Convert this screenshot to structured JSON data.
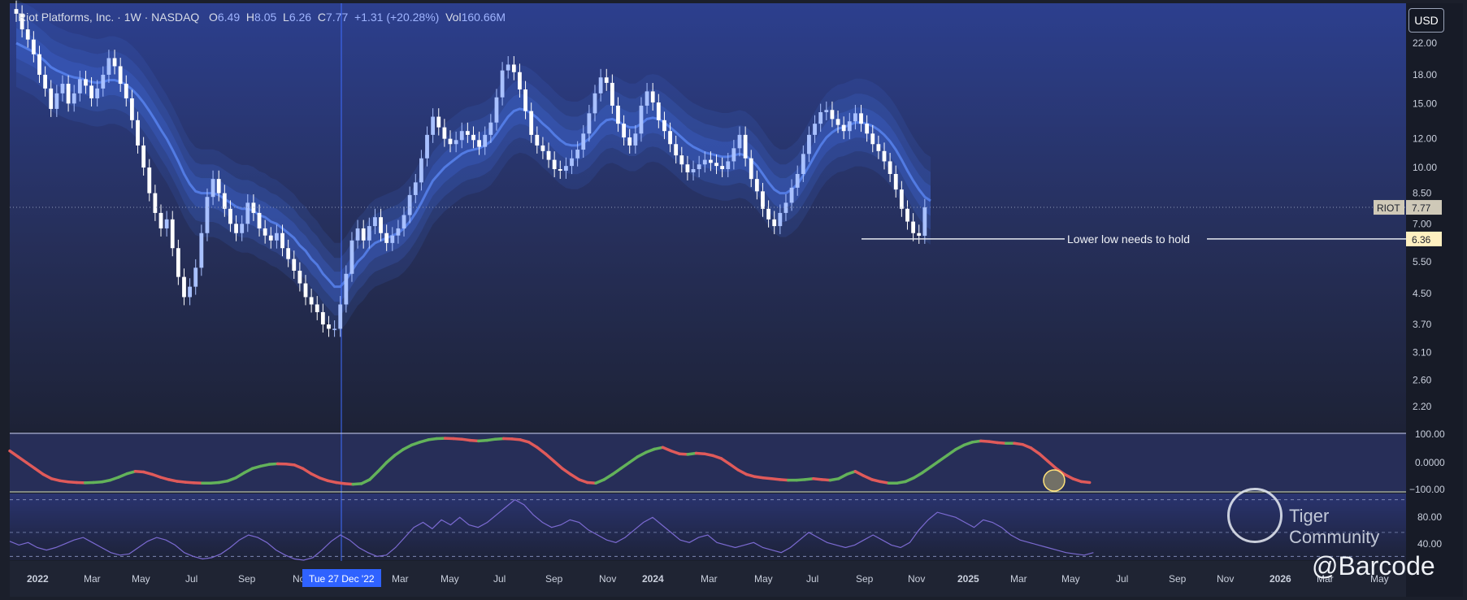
{
  "header": {
    "symbol_name": "Riot Platforms, Inc.",
    "interval": "1W",
    "exchange": "NASDAQ",
    "open_label": "O",
    "open": "6.49",
    "high_label": "H",
    "high": "8.05",
    "low_label": "L",
    "low": "6.26",
    "close_label": "C",
    "close": "7.77",
    "change": "+1.31 (+20.28%)",
    "vol_label": "Vol",
    "volume": "160.66M"
  },
  "currency_button": "USD",
  "watermark": {
    "brand": "Tiger Community",
    "handle": "@Barcode"
  },
  "colors": {
    "up": "#a9c1ff",
    "down": "#ffffff",
    "ribbon": "#3f68d6",
    "ribbon_teal": "#3fb8a8",
    "osc_up": "#63b25a",
    "osc_down": "#e05a5a",
    "rsi": "#7b6ad1",
    "accent": "#2f62ff"
  },
  "chart_data": {
    "type": "candlestick",
    "scale": "log",
    "price_axis_ticks": [
      "22.00",
      "18.00",
      "15.00",
      "12.00",
      "10.00",
      "8.50",
      "7.00",
      "5.50",
      "4.50",
      "3.70",
      "3.10",
      "2.60",
      "2.20"
    ],
    "price_axis_values": [
      22,
      18,
      15,
      12,
      10,
      8.5,
      7,
      5.5,
      4.5,
      3.7,
      3.1,
      2.6,
      2.2
    ],
    "time_axis_ticks": [
      "2022",
      "Mar",
      "May",
      "Jul",
      "Sep",
      "No",
      "Mar",
      "May",
      "Jul",
      "Sep",
      "Nov",
      "2024",
      "Mar",
      "May",
      "Jul",
      "Sep",
      "Nov",
      "2025",
      "Mar",
      "May",
      "Jul",
      "Sep",
      "Nov",
      "2026",
      "Mar",
      "May"
    ],
    "crosshair_date": "Tue 27 Dec '22",
    "price_labels": [
      {
        "name": "RIOT",
        "value": "7.77"
      },
      {
        "name": "",
        "value": "6.36"
      }
    ],
    "support_line": {
      "value": 6.36,
      "label": "Lower low needs to hold"
    },
    "oscillator_ticks": [
      "100.00",
      "0.0000",
      "−100.00"
    ],
    "rsi_ticks": [
      "80.00",
      "40.00"
    ],
    "closes": [
      26.5,
      24,
      22.5,
      20.5,
      18,
      16.5,
      14.5,
      16,
      17,
      15,
      16,
      17.5,
      16.8,
      15.5,
      16.5,
      18,
      20,
      19,
      17,
      15.5,
      13.5,
      11.5,
      10,
      8.5,
      7.5,
      6.8,
      7.2,
      6,
      5,
      4.4,
      4.7,
      5.3,
      6.6,
      8.3,
      9.3,
      8.5,
      7.7,
      7,
      6.6,
      7,
      8,
      7.5,
      6.8,
      6.5,
      6.3,
      6.6,
      6,
      5.6,
      5.2,
      4.8,
      4.4,
      4.2,
      4,
      3.7,
      3.6,
      3.6,
      4.2,
      5.1,
      6.3,
      6.8,
      6.3,
      6.9,
      7.3,
      6.6,
      6.2,
      6.5,
      6.8,
      7.4,
      8.4,
      9.1,
      10.6,
      12.3,
      13.8,
      12.9,
      12,
      11.6,
      11.9,
      12.6,
      12.3,
      11.9,
      11.4,
      12.3,
      13.3,
      15.6,
      18.5,
      19.2,
      18.3,
      16.4,
      14.3,
      12.3,
      11.5,
      11.1,
      10.5,
      9.9,
      9.8,
      10.1,
      10.6,
      11.2,
      12.4,
      14.1,
      16,
      17.7,
      17.1,
      14.8,
      13.2,
      12.1,
      11.5,
      12.4,
      14.8,
      16.2,
      15.1,
      13.5,
      12.6,
      11.6,
      10.8,
      10.2,
      9.7,
      9.9,
      10.2,
      10.5,
      10.3,
      10.1,
      9.9,
      10.4,
      11.3,
      12.3,
      10.6,
      9.3,
      8.6,
      7.7,
      7.2,
      6.9,
      7.5,
      8,
      8.8,
      9.6,
      10.9,
      12.3,
      13.2,
      14.2,
      14.4,
      13.6,
      13.1,
      12.6,
      13.4,
      14.1,
      13.2,
      12.4,
      11.6,
      11.1,
      10.4,
      9.6,
      8.7,
      7.7,
      7.1,
      6.6,
      6.49,
      7.77
    ],
    "ribbon_mid": [
      22,
      21.6,
      21.2,
      20.8,
      20.2,
      19.6,
      18.9,
      18.5,
      18.2,
      17.9,
      17.7,
      17.6,
      17.4,
      17.2,
      17.1,
      17.2,
      17.4,
      17.4,
      17.2,
      16.9,
      16.4,
      15.8,
      15.1,
      14.3,
      13.5,
      12.7,
      12,
      11.2,
      10.4,
      9.6,
      9,
      8.6,
      8.5,
      8.5,
      8.5,
      8.4,
      8.2,
      8,
      7.8,
      7.7,
      7.7,
      7.6,
      7.4,
      7.3,
      7.1,
      7,
      6.8,
      6.6,
      6.4,
      6.1,
      5.9,
      5.6,
      5.4,
      5.1,
      4.9,
      4.7,
      4.7,
      4.9,
      5.2,
      5.5,
      5.7,
      6,
      6.2,
      6.3,
      6.4,
      6.5,
      6.6,
      6.8,
      7.1,
      7.5,
      8,
      8.6,
      9.2,
      9.6,
      10,
      10.3,
      10.6,
      10.9,
      11.1,
      11.2,
      11.3,
      11.5,
      11.8,
      12.4,
      13.1,
      13.8,
      14.3,
      14.5,
      14.4,
      14.1,
      13.7,
      13.2,
      12.8,
      12.3,
      11.9,
      11.6,
      11.5,
      11.5,
      11.7,
      12,
      12.5,
      13.1,
      13.5,
      13.6,
      13.4,
      13.1,
      12.9,
      12.9,
      13.2,
      13.6,
      13.7,
      13.6,
      13.3,
      12.9,
      12.5,
      12.1,
      11.7,
      11.4,
      11.2,
      11,
      10.9,
      10.8,
      10.7,
      10.7,
      10.8,
      10.9,
      10.8,
      10.5,
      10.1,
      9.6,
      9.1,
      8.7,
      8.5,
      8.5,
      8.7,
      9,
      9.5,
      10.1,
      10.8,
      11.5,
      12.1,
      12.5,
      12.8,
      12.9,
      13.1,
      13.3,
      13.3,
      13.2,
      13,
      12.7,
      12.3,
      11.8,
      11.2,
      10.5,
      9.8,
      9.2,
      8.7,
      8.3,
      8.1
    ],
    "oscillator": [
      40,
      20,
      0,
      -20,
      -40,
      -55,
      -62,
      -66,
      -68,
      -69,
      -68,
      -66,
      -60,
      -50,
      -38,
      -30,
      -32,
      -40,
      -50,
      -58,
      -64,
      -67,
      -69,
      -70,
      -70,
      -68,
      -63,
      -52,
      -35,
      -20,
      -12,
      -6,
      -4,
      -5,
      -8,
      -20,
      -38,
      -52,
      -62,
      -68,
      -72,
      -74,
      -72,
      -58,
      -30,
      0,
      25,
      45,
      60,
      70,
      78,
      82,
      83,
      82,
      80,
      76,
      74,
      76,
      80,
      82,
      81,
      78,
      70,
      52,
      30,
      5,
      -20,
      -40,
      -58,
      -68,
      -70,
      -58,
      -40,
      -20,
      0,
      20,
      35,
      46,
      52,
      40,
      30,
      28,
      32,
      30,
      24,
      14,
      -5,
      -25,
      -40,
      -48,
      -52,
      -55,
      -58,
      -60,
      -60,
      -58,
      -55,
      -58,
      -60,
      -55,
      -40,
      -30,
      -45,
      -58,
      -65,
      -70,
      -70,
      -65,
      -52,
      -35,
      -15,
      5,
      25,
      45,
      60,
      70,
      74,
      72,
      68,
      66,
      66,
      62,
      50,
      30,
      5,
      -20,
      -40,
      -55,
      -65,
      -68
    ],
    "rsi": [
      45,
      42,
      44,
      40,
      38,
      40,
      43,
      46,
      48,
      44,
      40,
      36,
      34,
      35,
      40,
      45,
      48,
      46,
      42,
      36,
      33,
      31,
      32,
      35,
      40,
      46,
      50,
      48,
      44,
      38,
      34,
      31,
      30,
      32,
      38,
      45,
      50,
      46,
      40,
      36,
      33,
      34,
      40,
      48,
      56,
      60,
      55,
      62,
      58,
      64,
      58,
      56,
      60,
      66,
      72,
      78,
      74,
      66,
      60,
      56,
      58,
      62,
      60,
      54,
      50,
      46,
      44,
      48,
      54,
      60,
      64,
      58,
      52,
      46,
      44,
      48,
      50,
      44,
      42,
      40,
      42,
      44,
      40,
      38,
      36,
      40,
      46,
      52,
      48,
      44,
      42,
      40,
      42,
      46,
      50,
      46,
      42,
      40,
      44,
      54,
      62,
      68,
      66,
      64,
      60,
      56,
      62,
      60,
      56,
      50,
      46,
      44,
      42,
      40,
      38,
      36,
      35,
      34,
      36
    ]
  }
}
